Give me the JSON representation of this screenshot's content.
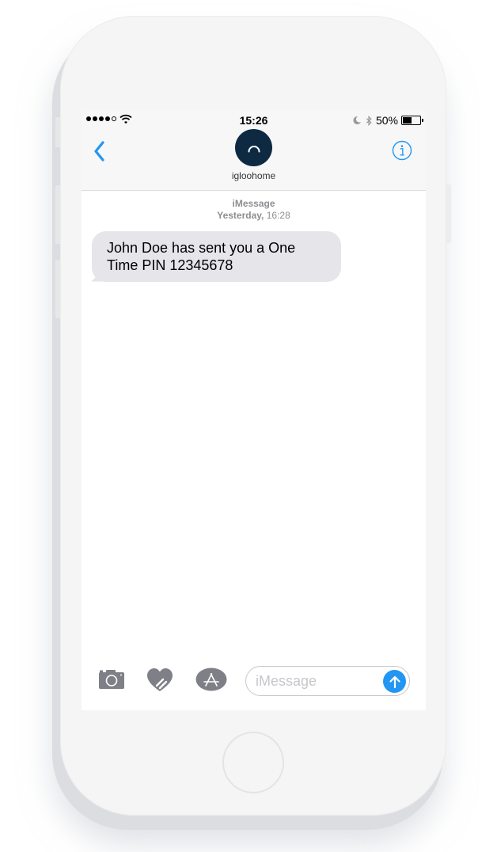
{
  "status_bar": {
    "signal_bars_filled": 4,
    "signal_bars_total": 5,
    "time": "15:26",
    "battery_percent_label": "50%",
    "battery_level": 0.5,
    "icons": [
      "signal-dots-icon",
      "wifi-icon",
      "moon-icon",
      "bluetooth-icon",
      "battery-icon"
    ]
  },
  "nav": {
    "back_icon": "chevron-left-icon",
    "info_icon": "info-circle-icon",
    "contact_name": "igloohome",
    "avatar_icon": "igloo-arc-icon",
    "avatar_color": "#0e2a43"
  },
  "thread": {
    "service": "iMessage",
    "day": "Yesterday,",
    "time": "16:28",
    "messages": [
      {
        "direction": "incoming",
        "text": "John Doe has sent you a One\nTime PIN 12345678"
      }
    ]
  },
  "compose": {
    "camera_icon": "camera-icon",
    "digital_touch_icon": "heart-touch-icon",
    "app_store_icon": "app-store-icon",
    "placeholder": "iMessage",
    "value": "",
    "send_icon": "arrow-up-icon",
    "accent_color": "#2196f3"
  },
  "colors": {
    "ios_blue": "#2196f3",
    "bubble_gray": "#e5e5ea",
    "meta_gray": "#8e8e93",
    "icon_gray": "#7f8087"
  }
}
